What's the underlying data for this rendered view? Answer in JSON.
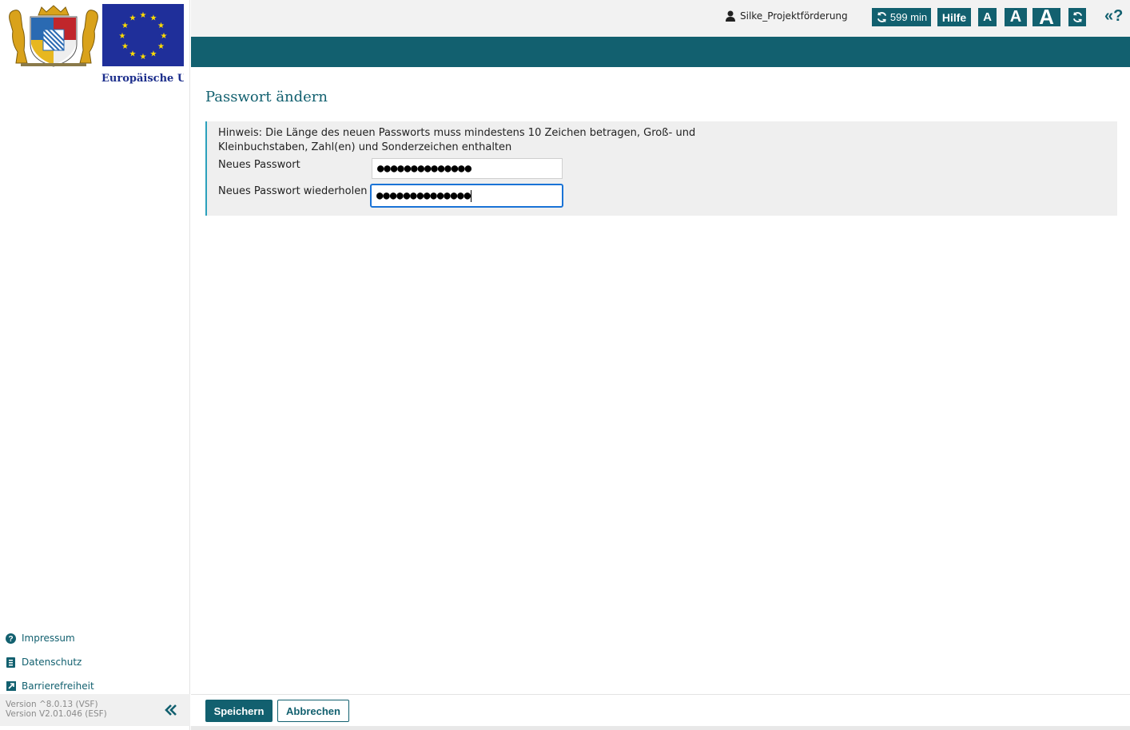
{
  "branding": {
    "eu_label": "Europäische Union"
  },
  "header": {
    "user_name": "Silke_Projektförderung",
    "session_timer": "599 min",
    "help_label": "Hilfe",
    "font_small": "A",
    "font_medium": "A",
    "font_large": "A",
    "help_toggle": "«?"
  },
  "main": {
    "title": "Passwort ändern",
    "hint": "Hinweis: Die Länge des neuen Passworts muss mindestens 10 Zeichen betragen, Groß- und Kleinbuchstaben, Zahl(en) und Sonderzeichen enthalten",
    "new_password_label": "Neues Passwort",
    "new_password_value": "●●●●●●●●●●●●●●",
    "repeat_password_label": "Neues Passwort wiederholen",
    "repeat_password_value": "●●●●●●●●●●●●●●"
  },
  "sidebar": {
    "links": [
      {
        "label": "Impressum",
        "icon": "question-circle-icon"
      },
      {
        "label": "Datenschutz",
        "icon": "document-icon"
      },
      {
        "label": "Barrierefreiheit",
        "icon": "external-link-icon"
      }
    ],
    "version_line1": "Version ^8.0.13 (VSF)",
    "version_line2": "Version V2.01.046 (ESF)"
  },
  "actions": {
    "save_label": "Speichern",
    "cancel_label": "Abbrechen"
  },
  "colors": {
    "primary": "#12606f",
    "accent_border": "#2aa0bc",
    "focus": "#1a73d6",
    "eu_blue": "#1f2f9a",
    "eu_star": "#ffdd00"
  }
}
